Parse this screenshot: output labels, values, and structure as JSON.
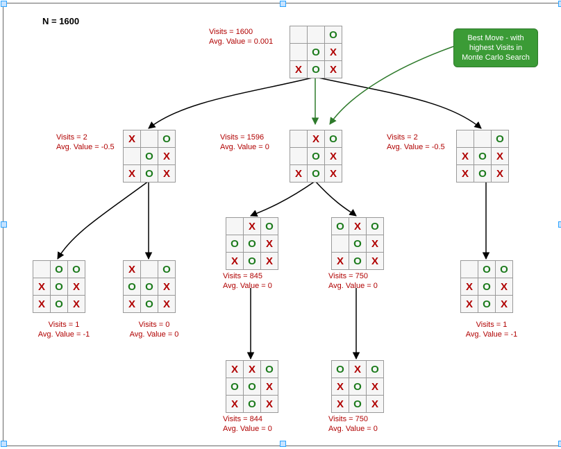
{
  "title": "N = 1600",
  "callout": {
    "line1": "Best Move - with",
    "line2": "highest Visits in",
    "line3": "Monte Carlo Search"
  },
  "nodes": {
    "root": {
      "visits": "Visits = 1600",
      "value": "Avg. Value = 0.001",
      "board": [
        "",
        "",
        "O",
        "",
        "O",
        "X",
        "X",
        "O",
        "X"
      ]
    },
    "l1a": {
      "visits": "Visits = 2",
      "value": "Avg. Value = -0.5",
      "board": [
        "X",
        "",
        "O",
        "",
        "O",
        "X",
        "X",
        "O",
        "X"
      ]
    },
    "l1b": {
      "visits": "Visits = 1596",
      "value": "Avg. Value = 0",
      "board": [
        "",
        "X",
        "O",
        "",
        "O",
        "X",
        "X",
        "O",
        "X"
      ]
    },
    "l1c": {
      "visits": "Visits = 2",
      "value": "Avg. Value = -0.5",
      "board": [
        "",
        "",
        "O",
        "X",
        "O",
        "X",
        "X",
        "O",
        "X"
      ]
    },
    "l2a": {
      "visits": "Visits = 1",
      "value": "Avg. Value = -1",
      "board": [
        "",
        "O",
        "O",
        "X",
        "O",
        "X",
        "X",
        "O",
        "X"
      ]
    },
    "l2b": {
      "visits": "Visits = 0",
      "value": "Avg. Value = 0",
      "board": [
        "X",
        "",
        "O",
        "O",
        "O",
        "X",
        "X",
        "O",
        "X"
      ]
    },
    "l2c": {
      "visits": "Visits = 845",
      "value": "Avg. Value = 0",
      "board": [
        "",
        "X",
        "O",
        "O",
        "O",
        "X",
        "X",
        "O",
        "X"
      ]
    },
    "l2d": {
      "visits": "Visits = 750",
      "value": "Avg. Value = 0",
      "board": [
        "O",
        "X",
        "O",
        "",
        "O",
        "X",
        "X",
        "O",
        "X"
      ]
    },
    "l2e": {
      "visits": "Visits = 1",
      "value": "Avg. Value = -1",
      "board": [
        "",
        "O",
        "O",
        "X",
        "O",
        "X",
        "X",
        "O",
        "X"
      ]
    },
    "l3a": {
      "visits": "Visits = 844",
      "value": "Avg. Value = 0",
      "board": [
        "X",
        "X",
        "O",
        "O",
        "O",
        "X",
        "X",
        "O",
        "X"
      ]
    },
    "l3b": {
      "visits": "Visits = 750",
      "value": "Avg. Value = 0",
      "board": [
        "O",
        "X",
        "O",
        "X",
        "O",
        "X",
        "X",
        "O",
        "X"
      ]
    }
  }
}
